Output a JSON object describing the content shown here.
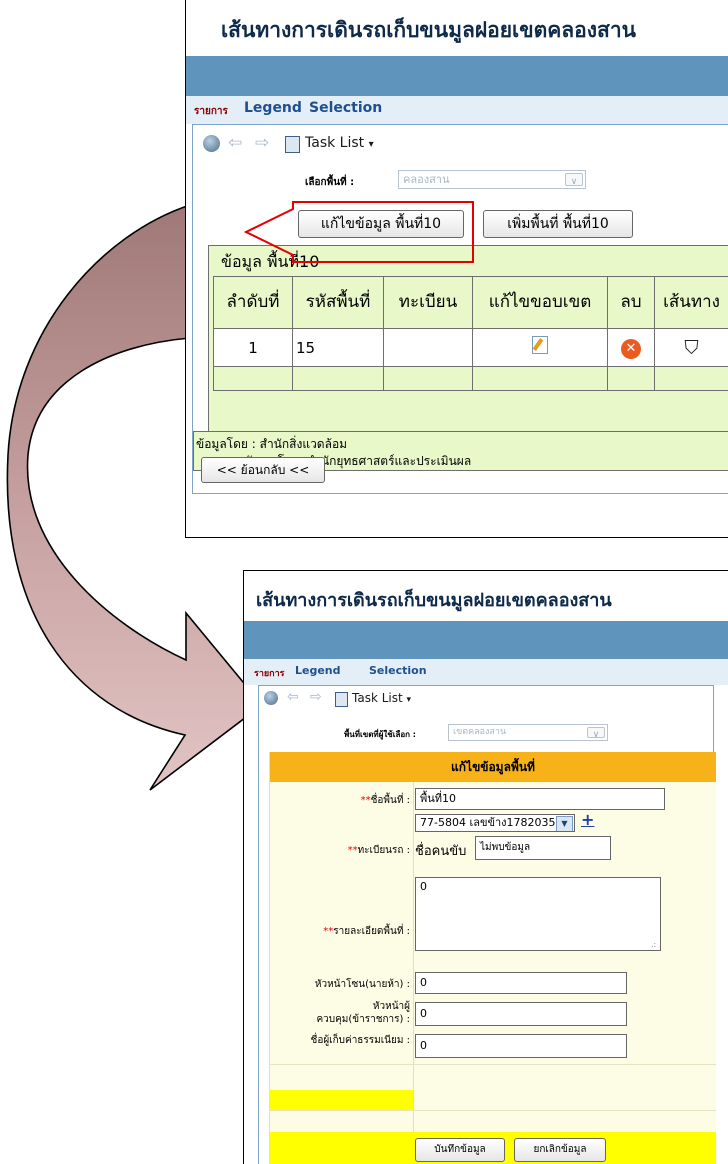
{
  "top": {
    "title": "เส้นทางการเดินรถเก็บขนมูลฝอยเขตคลองสาน",
    "tabs": [
      "รายการ",
      "Legend",
      "Selection"
    ],
    "toolbar_task": "Task List",
    "select_label": "เลือกพื้นที่ :",
    "select_value": "คลองสาน",
    "edit_button": "แก้ไขข้อมูล พื้นที่10",
    "add_button": "เพิ่มพื้นที่ พื้นที่10",
    "table_caption": "ข้อมูล พื้นที่10",
    "headers": [
      "ลำดับที่",
      "รหัสพื้นที่",
      "ทะเบียน",
      "แก้ไขขอบเขต",
      "ลบ",
      "เส้นทาง"
    ],
    "row": {
      "num": "1",
      "code": "15",
      "reg": ""
    },
    "credit1": "ข้อมูลโดย : สำนักสิ่งแวดล้อม",
    "credit2": "พัฒนาโดย: สำนักยุทธศาสตร์และประเมินผล",
    "back_button": "<< ย้อนกลับ <<"
  },
  "bottom": {
    "title": "เส้นทางการเดินรถเก็บขนมูลฝอยเขตคลองสาน",
    "tabs": [
      "รายการ",
      "Legend",
      "Selection"
    ],
    "toolbar_task": "Task List",
    "select_label": "พื้นที่เขตที่ผู้ใช้เลือก :",
    "select_value": "เขตคลองสาน",
    "form_header": "แก้ไขข้อมูลพื้นที่",
    "required_mark": "**",
    "area_name_label": "ชื่อพื้นที่ :",
    "area_name_value": "พื้นที่10",
    "plate_label": "ทะเบียนรถ :",
    "plate_value": "77-5804 เลขข้าง1782035",
    "plate_add": "+",
    "driver_label": "ชื่อคนขับ",
    "driver_value": "ไม่พบข้อมูล",
    "detail_label": "รายละเอียดพื้นที่ :",
    "detail_value": "0",
    "zone_head_label": "หัวหน้าโซน(นายห้า) :",
    "zone_head_value": "0",
    "supervisor_label": "หัวหน้าผู้ควบคุม(ข้าราชการ) :",
    "supervisor_value": "0",
    "collector_label": "ชื่อผู้เก็บค่าธรรมเนียม :",
    "collector_value": "0",
    "save_button": "บันทึกข้อมูล",
    "cancel_button": "ยกเลิกข้อมูล"
  },
  "colors": {
    "banner": "#5f94bd",
    "form_header": "#f7b21a",
    "yellow_row": "#ffff00",
    "table_bg": "#e8f8c8",
    "highlight": "#e60000",
    "arrow_fill": "#b88c8c"
  }
}
